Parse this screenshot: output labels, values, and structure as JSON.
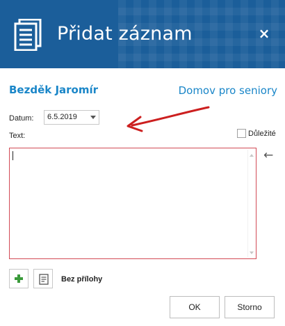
{
  "header": {
    "title": "Přidat záznam",
    "close_glyph": "×",
    "icon": "document-icon",
    "background_color": "#1b5e9a"
  },
  "client": {
    "name": "Bezděk Jaromír",
    "facility": "Domov pro seniory",
    "accent_color": "#1a86c8"
  },
  "form": {
    "date_label": "Datum:",
    "date_value": "6.5.2019",
    "text_label": "Text:",
    "important_label": "Důležité",
    "important_checked": false,
    "text_value": "",
    "textarea_border_color": "#d24a55"
  },
  "side_arrow_glyph": "←",
  "annotation_arrow_color": "#cc1f1f",
  "attachments": {
    "add_icon": "plus-icon",
    "attach_icon": "document-list-icon",
    "status": "Bez přílohy"
  },
  "footer": {
    "ok_label": "OK",
    "cancel_label": "Storno"
  }
}
